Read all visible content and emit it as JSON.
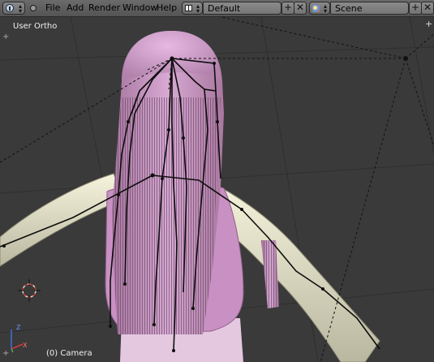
{
  "header": {
    "menu": {
      "file": "File",
      "add": "Add",
      "render": "Render",
      "window": "Window",
      "help": "Help"
    },
    "screen_layout": "Default",
    "scene": "Scene",
    "add_symbol": "+",
    "remove_symbol": "✕"
  },
  "viewport": {
    "view_label": "User Ortho",
    "object_label": "(0) Camera",
    "axis_x": "X",
    "axis_z": "Z",
    "region_toggle": "+"
  },
  "colors": {
    "viewport_bg": "#3a3a3a",
    "grid_line": "#2f2f2f",
    "hair": "#c89cc6",
    "body_skin": "#e6e4cc",
    "bone": "#0e0e0e"
  }
}
